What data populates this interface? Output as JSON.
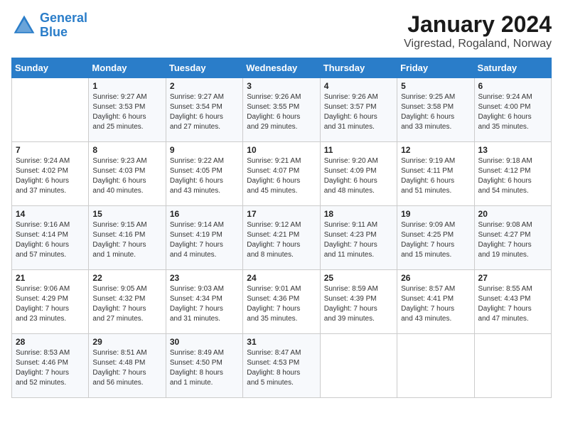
{
  "header": {
    "logo_line1": "General",
    "logo_line2": "Blue",
    "month": "January 2024",
    "location": "Vigrestad, Rogaland, Norway"
  },
  "weekdays": [
    "Sunday",
    "Monday",
    "Tuesday",
    "Wednesday",
    "Thursday",
    "Friday",
    "Saturday"
  ],
  "weeks": [
    [
      {
        "day": "",
        "info": ""
      },
      {
        "day": "1",
        "info": "Sunrise: 9:27 AM\nSunset: 3:53 PM\nDaylight: 6 hours\nand 25 minutes."
      },
      {
        "day": "2",
        "info": "Sunrise: 9:27 AM\nSunset: 3:54 PM\nDaylight: 6 hours\nand 27 minutes."
      },
      {
        "day": "3",
        "info": "Sunrise: 9:26 AM\nSunset: 3:55 PM\nDaylight: 6 hours\nand 29 minutes."
      },
      {
        "day": "4",
        "info": "Sunrise: 9:26 AM\nSunset: 3:57 PM\nDaylight: 6 hours\nand 31 minutes."
      },
      {
        "day": "5",
        "info": "Sunrise: 9:25 AM\nSunset: 3:58 PM\nDaylight: 6 hours\nand 33 minutes."
      },
      {
        "day": "6",
        "info": "Sunrise: 9:24 AM\nSunset: 4:00 PM\nDaylight: 6 hours\nand 35 minutes."
      }
    ],
    [
      {
        "day": "7",
        "info": "Sunrise: 9:24 AM\nSunset: 4:02 PM\nDaylight: 6 hours\nand 37 minutes."
      },
      {
        "day": "8",
        "info": "Sunrise: 9:23 AM\nSunset: 4:03 PM\nDaylight: 6 hours\nand 40 minutes."
      },
      {
        "day": "9",
        "info": "Sunrise: 9:22 AM\nSunset: 4:05 PM\nDaylight: 6 hours\nand 43 minutes."
      },
      {
        "day": "10",
        "info": "Sunrise: 9:21 AM\nSunset: 4:07 PM\nDaylight: 6 hours\nand 45 minutes."
      },
      {
        "day": "11",
        "info": "Sunrise: 9:20 AM\nSunset: 4:09 PM\nDaylight: 6 hours\nand 48 minutes."
      },
      {
        "day": "12",
        "info": "Sunrise: 9:19 AM\nSunset: 4:11 PM\nDaylight: 6 hours\nand 51 minutes."
      },
      {
        "day": "13",
        "info": "Sunrise: 9:18 AM\nSunset: 4:12 PM\nDaylight: 6 hours\nand 54 minutes."
      }
    ],
    [
      {
        "day": "14",
        "info": "Sunrise: 9:16 AM\nSunset: 4:14 PM\nDaylight: 6 hours\nand 57 minutes."
      },
      {
        "day": "15",
        "info": "Sunrise: 9:15 AM\nSunset: 4:16 PM\nDaylight: 7 hours\nand 1 minute."
      },
      {
        "day": "16",
        "info": "Sunrise: 9:14 AM\nSunset: 4:19 PM\nDaylight: 7 hours\nand 4 minutes."
      },
      {
        "day": "17",
        "info": "Sunrise: 9:12 AM\nSunset: 4:21 PM\nDaylight: 7 hours\nand 8 minutes."
      },
      {
        "day": "18",
        "info": "Sunrise: 9:11 AM\nSunset: 4:23 PM\nDaylight: 7 hours\nand 11 minutes."
      },
      {
        "day": "19",
        "info": "Sunrise: 9:09 AM\nSunset: 4:25 PM\nDaylight: 7 hours\nand 15 minutes."
      },
      {
        "day": "20",
        "info": "Sunrise: 9:08 AM\nSunset: 4:27 PM\nDaylight: 7 hours\nand 19 minutes."
      }
    ],
    [
      {
        "day": "21",
        "info": "Sunrise: 9:06 AM\nSunset: 4:29 PM\nDaylight: 7 hours\nand 23 minutes."
      },
      {
        "day": "22",
        "info": "Sunrise: 9:05 AM\nSunset: 4:32 PM\nDaylight: 7 hours\nand 27 minutes."
      },
      {
        "day": "23",
        "info": "Sunrise: 9:03 AM\nSunset: 4:34 PM\nDaylight: 7 hours\nand 31 minutes."
      },
      {
        "day": "24",
        "info": "Sunrise: 9:01 AM\nSunset: 4:36 PM\nDaylight: 7 hours\nand 35 minutes."
      },
      {
        "day": "25",
        "info": "Sunrise: 8:59 AM\nSunset: 4:39 PM\nDaylight: 7 hours\nand 39 minutes."
      },
      {
        "day": "26",
        "info": "Sunrise: 8:57 AM\nSunset: 4:41 PM\nDaylight: 7 hours\nand 43 minutes."
      },
      {
        "day": "27",
        "info": "Sunrise: 8:55 AM\nSunset: 4:43 PM\nDaylight: 7 hours\nand 47 minutes."
      }
    ],
    [
      {
        "day": "28",
        "info": "Sunrise: 8:53 AM\nSunset: 4:46 PM\nDaylight: 7 hours\nand 52 minutes."
      },
      {
        "day": "29",
        "info": "Sunrise: 8:51 AM\nSunset: 4:48 PM\nDaylight: 7 hours\nand 56 minutes."
      },
      {
        "day": "30",
        "info": "Sunrise: 8:49 AM\nSunset: 4:50 PM\nDaylight: 8 hours\nand 1 minute."
      },
      {
        "day": "31",
        "info": "Sunrise: 8:47 AM\nSunset: 4:53 PM\nDaylight: 8 hours\nand 5 minutes."
      },
      {
        "day": "",
        "info": ""
      },
      {
        "day": "",
        "info": ""
      },
      {
        "day": "",
        "info": ""
      }
    ]
  ]
}
